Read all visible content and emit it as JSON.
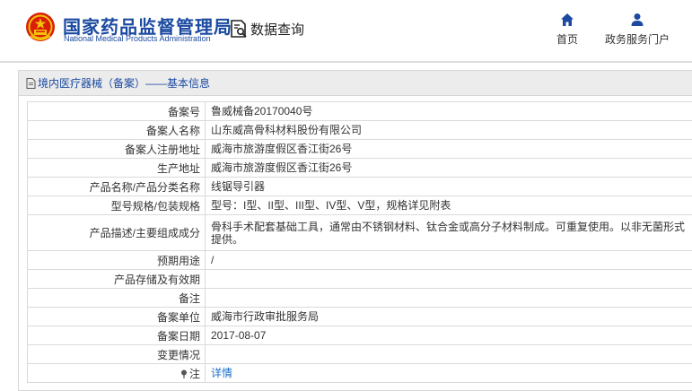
{
  "header": {
    "org_name_cn": "国家药品监督管理局",
    "org_name_en": "National Medical Products Administration",
    "db_query_label": "数据查询",
    "nav": {
      "home_label": "首页",
      "portal_label": "政务服务门户"
    }
  },
  "panel": {
    "title": "境内医疗器械（备案）——基本信息",
    "rows": [
      {
        "label": "备案号",
        "value": "鲁威械备20170040号"
      },
      {
        "label": "备案人名称",
        "value": "山东威高骨科材料股份有限公司"
      },
      {
        "label": "备案人注册地址",
        "value": "威海市旅游度假区香江街26号"
      },
      {
        "label": "生产地址",
        "value": "威海市旅游度假区香江街26号"
      },
      {
        "label": "产品名称/产品分类名称",
        "value": "线锯导引器"
      },
      {
        "label": "型号规格/包装规格",
        "value": "型号：I型、II型、III型、IV型、V型，规格详见附表"
      },
      {
        "label": "产品描述/主要组成成分",
        "value": "骨科手术配套基础工具，通常由不锈钢材料、钛合金或高分子材料制成。可重复使用。以非无菌形式提供。"
      },
      {
        "label": "预期用途",
        "value": "/"
      },
      {
        "label": "产品存储及有效期",
        "value": ""
      },
      {
        "label": "备注",
        "value": ""
      },
      {
        "label": "备案单位",
        "value": "威海市行政审批服务局"
      },
      {
        "label": "备案日期",
        "value": "2017-08-07"
      },
      {
        "label": "变更情况",
        "value": ""
      },
      {
        "label": "注",
        "value": "详情"
      }
    ]
  },
  "colors": {
    "brand_blue": "#1b4aa0",
    "link_blue": "#1b6fc8",
    "header_bar": "#ececec"
  },
  "icons": [
    "national-emblem",
    "search-document-icon",
    "home-icon",
    "user-icon",
    "document-icon",
    "pin-icon"
  ]
}
